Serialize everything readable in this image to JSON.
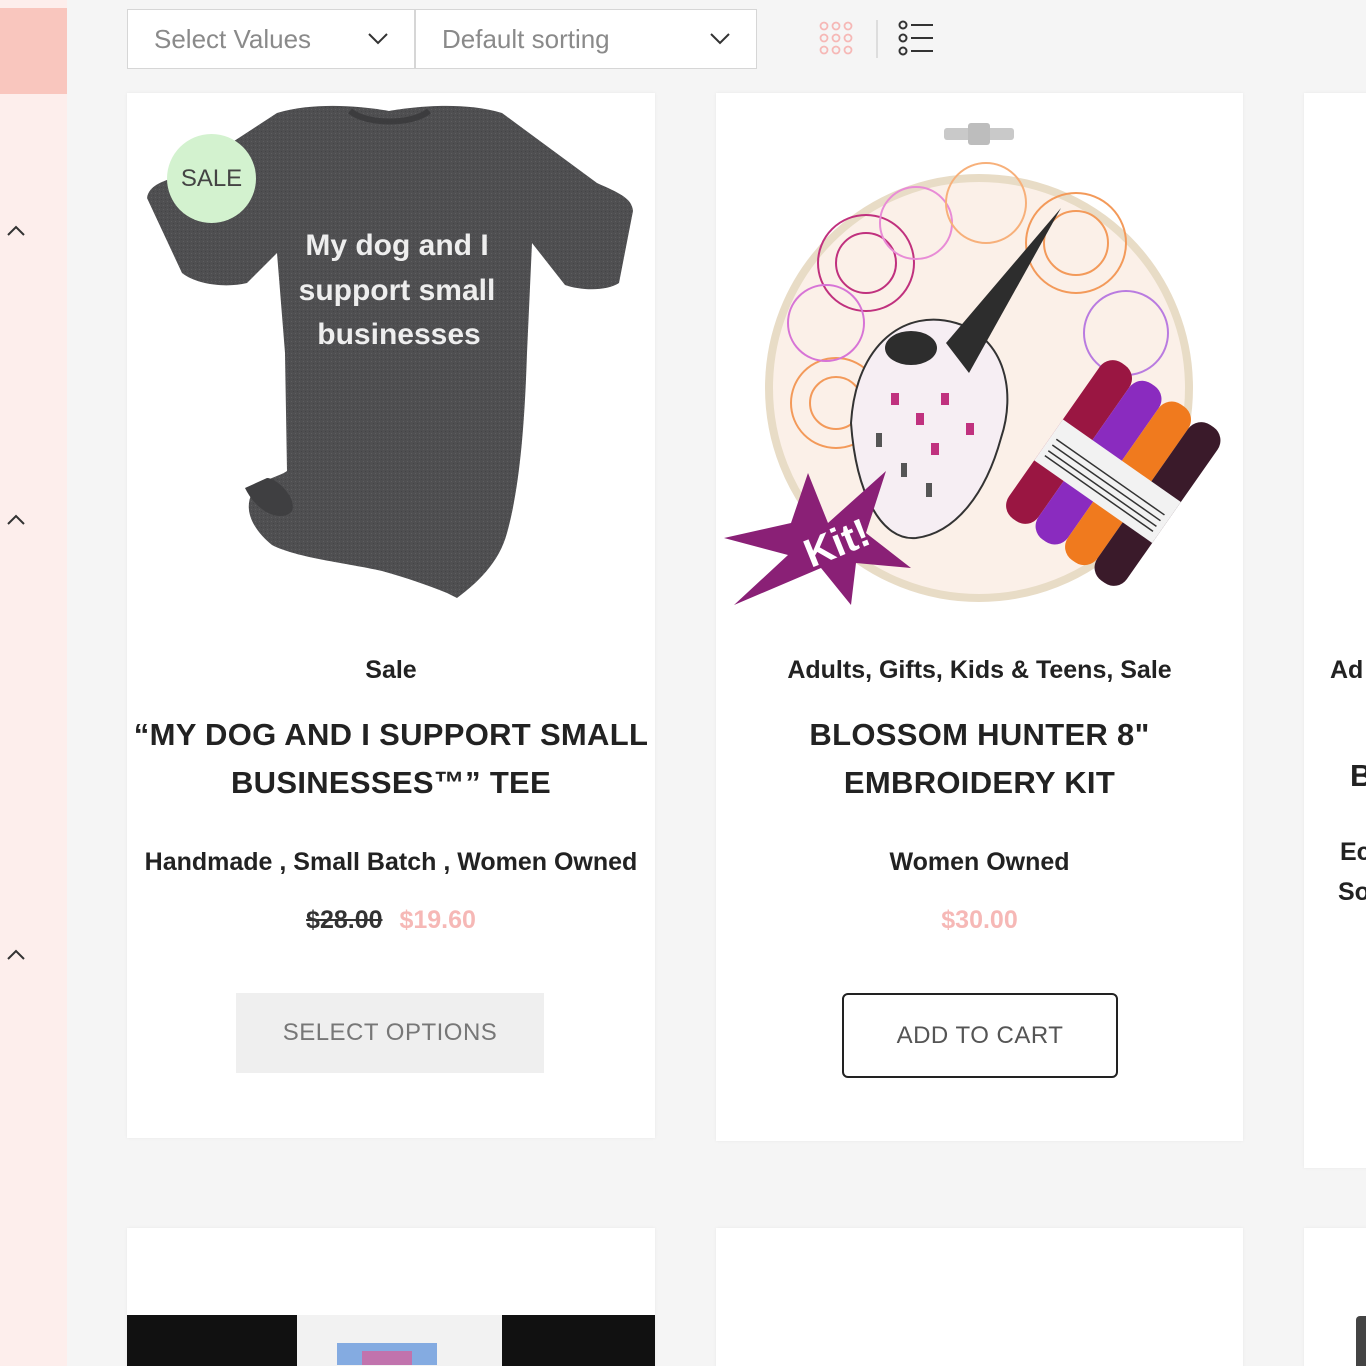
{
  "toolbar": {
    "select_values": "Select Values",
    "sorting": "Default sorting"
  },
  "colors": {
    "sidebar_bg": "#fdeeec",
    "sidebar_accent": "#f9c6be",
    "sale_badge": "#d3f2cf",
    "sale_price": "#f6b8b6",
    "grid_icon_active": "#f6b8b6"
  },
  "products": [
    {
      "badge": "SALE",
      "image_text": [
        "My dog and I",
        "support small",
        "businesses"
      ],
      "categories": "Sale",
      "title_line1": "“MY DOG AND I SUPPORT SMALL",
      "title_line2": "BUSINESSES™” TEE",
      "tags": "Handmade , Small Batch , Women Owned",
      "old_price": "$28.00",
      "price": "$19.60",
      "button": "SELECT OPTIONS"
    },
    {
      "image_badge": "Kit!",
      "categories": "Adults, Gifts, Kids & Teens, Sale",
      "title_line1": "BLOSSOM HUNTER 8\"",
      "title_line2": "EMBROIDERY KIT",
      "tags": "Women Owned",
      "price": "$30.00",
      "button": "ADD TO CART"
    },
    {
      "categories_partial": "Ad",
      "title_partial": "B",
      "tags_partial_1": "Ec",
      "tags_partial_2": "So"
    }
  ],
  "icons": {
    "sidebar": [
      "chevron-up-icon",
      "chevron-up-icon",
      "chevron-up-icon"
    ],
    "view": [
      "grid-view-icon",
      "list-view-icon"
    ],
    "select": "chevron-down-icon"
  }
}
